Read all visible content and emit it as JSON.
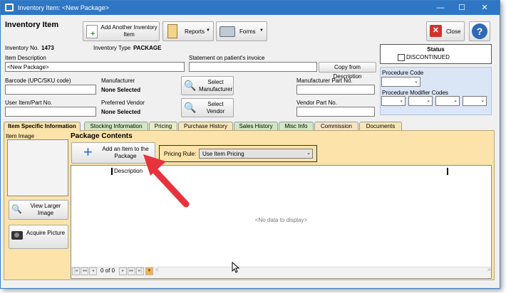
{
  "window": {
    "title": "Inventory Item: <New Package>",
    "minimize": "—",
    "maximize": "☐",
    "close": "✕"
  },
  "header": {
    "heading": "Inventory Item",
    "add_another": "Add Another Inventory Item",
    "reports": "Reports",
    "forms": "Forms",
    "close": "Close",
    "help": "?"
  },
  "info": {
    "inventory_no_label": "Inventory No.",
    "inventory_no_value": "1473",
    "inventory_type_label": "Inventory Type",
    "inventory_type_value": "PACKAGE"
  },
  "status": {
    "title": "Status",
    "discontinued_label": "DISCONTINUED",
    "discontinued_checked": false
  },
  "form": {
    "item_description_label": "Item Description",
    "item_description_value": "<New Package>",
    "statement_label": "Statement on patient's invoice",
    "statement_value": "",
    "copy_from_description": "Copy from Description",
    "barcode_label": "Barcode (UPC/SKU code)",
    "barcode_value": "",
    "manufacturer_label": "Manufacturer",
    "manufacturer_value": "None Selected",
    "select_manufacturer": "Select Manufacturer",
    "manufacturer_part_label": "Manufacturer Part No.",
    "manufacturer_part_value": "",
    "user_item_label": "User Item/Part No.",
    "user_item_value": "",
    "preferred_vendor_label": "Preferred Vendor",
    "preferred_vendor_value": "None Selected",
    "select_vendor": "Select Vendor",
    "vendor_part_label": "Vendor Part No.",
    "vendor_part_value": "",
    "procedure_code_label": "Procedure Code",
    "procedure_modifier_label": "Procedure Modifier Codes"
  },
  "tabs": [
    {
      "label": "Item Specific Information",
      "color": "#fbe3a9",
      "active": true
    },
    {
      "label": "Stocking Information",
      "color": "#cfe8c4"
    },
    {
      "label": "Pricing",
      "color": "#e7ecc4"
    },
    {
      "label": "Purchase History",
      "color": "#f7e6b4"
    },
    {
      "label": "Sales History",
      "color": "#cfe8c4"
    },
    {
      "label": "Misc Info",
      "color": "#cfe8c4"
    },
    {
      "label": "Commission",
      "color": "#f7e3c4"
    },
    {
      "label": "Documents",
      "color": "#f7e6b4"
    }
  ],
  "panel": {
    "item_image_label": "Item Image",
    "view_larger": "View Larger Image",
    "acquire": "Acquire Picture",
    "package_contents": "Package Contents",
    "add_item": "Add an Item to the Package",
    "pricing_rule_label": "Pricing Rule:",
    "pricing_rule_value": "Use Item Pricing",
    "grid_column": "Description",
    "empty_text": "<No data to display>",
    "pager_text": "0 of 0"
  },
  "colors": {
    "titlebar": "#2f77c4",
    "tab_panel": "#fbe3a9",
    "arrow": "#e8323c"
  }
}
